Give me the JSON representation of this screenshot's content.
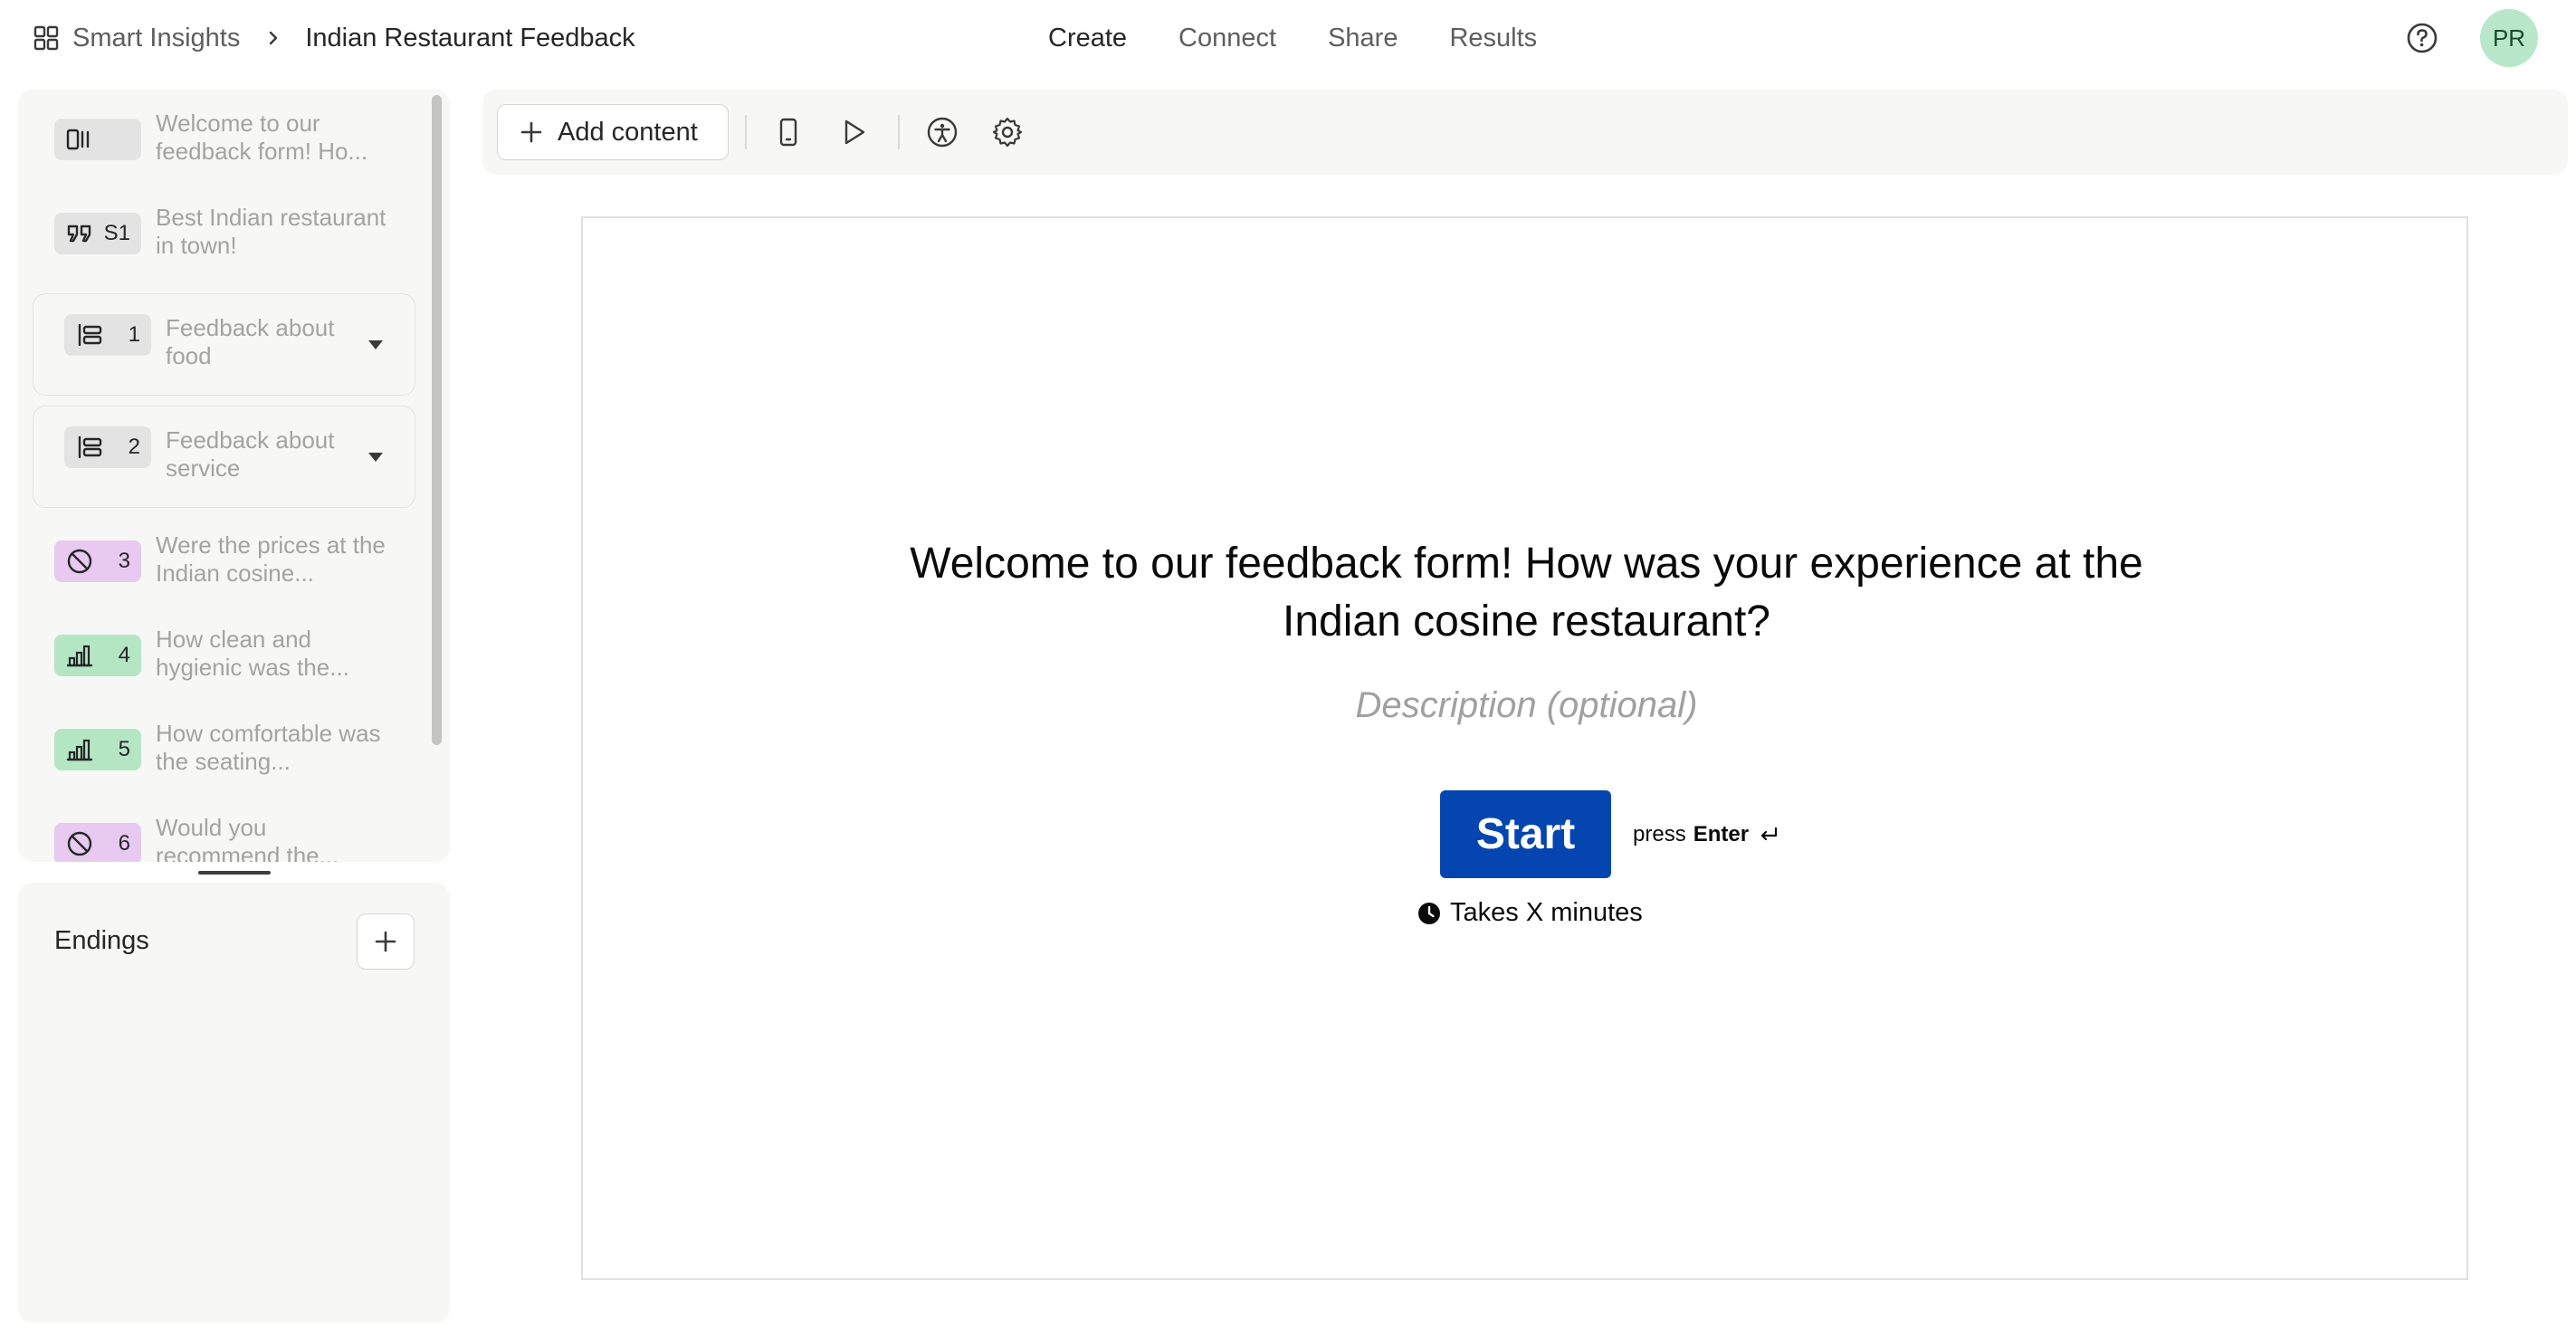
{
  "header": {
    "workspace_name": "Smart Insights",
    "form_title": "Indian Restaurant Feedback",
    "nav": [
      {
        "label": "Create"
      },
      {
        "label": "Connect"
      },
      {
        "label": "Share"
      },
      {
        "label": "Results"
      }
    ],
    "avatar_initials": "PR"
  },
  "toolbar": {
    "add_content_label": "Add content"
  },
  "sidebar": {
    "items": [
      {
        "badge": "",
        "text": "Welcome to our feedback form! Ho...",
        "icon": "welcome-screen-icon"
      },
      {
        "badge": "S1",
        "text": "Best Indian restaurant in town!",
        "icon": "quote-icon"
      },
      {
        "badge": "1",
        "text": "Feedback about food",
        "icon": "question-group-icon"
      },
      {
        "badge": "2",
        "text": "Feedback about service",
        "icon": "question-group-icon"
      },
      {
        "badge": "3",
        "text": "Were the prices at the Indian cosine...",
        "icon": "yes-no-icon"
      },
      {
        "badge": "4",
        "text": "How clean and hygienic was the...",
        "icon": "opinion-scale-icon"
      },
      {
        "badge": "5",
        "text": "How comfortable was the seating...",
        "icon": "opinion-scale-icon"
      },
      {
        "badge": "6",
        "text": "Would you recommend the...",
        "icon": "yes-no-icon"
      }
    ],
    "endings_label": "Endings"
  },
  "canvas": {
    "title_line1": "Welcome to our feedback form! How was your experience at the",
    "title_line2": "Indian cosine restaurant?",
    "description_placeholder": "Description (optional)",
    "start_label": "Start",
    "press_label": "press",
    "enter_label": "Enter",
    "time_label": "Takes X minutes"
  },
  "colors": {
    "start_button": "#0445af",
    "badge_purple": "#e8c9f0",
    "badge_green": "#b4e6c4",
    "badge_gray": "#e3e3e3",
    "avatar_bg": "#b8e7c9"
  }
}
